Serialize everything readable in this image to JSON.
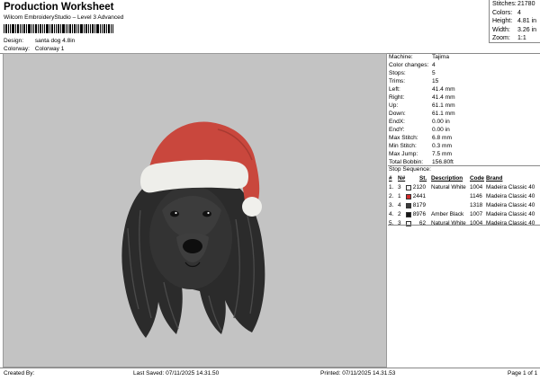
{
  "header": {
    "title": "Production Worksheet",
    "subtitle": "Wilcom EmbroideryStudio – Level 3 Advanced",
    "design_label": "Design:",
    "design_value": "santa dog 4.8in",
    "colorway_label": "Colorway:",
    "colorway_value": "Colorway 1"
  },
  "stats": [
    {
      "label": "Stitches:",
      "value": "21780"
    },
    {
      "label": "Colors:",
      "value": "4"
    },
    {
      "label": "Height:",
      "value": "4.81 in"
    },
    {
      "label": "Width:",
      "value": "3.26 in"
    },
    {
      "label": "Zoom:",
      "value": "1:1"
    }
  ],
  "info": [
    {
      "label": "Machine:",
      "value": "Tajima"
    },
    {
      "label": "Color changes:",
      "value": "4"
    },
    {
      "label": "Stops:",
      "value": "5"
    },
    {
      "label": "Trims:",
      "value": "15"
    },
    {
      "label": "Left:",
      "value": "41.4 mm"
    },
    {
      "label": "Right:",
      "value": "41.4 mm"
    },
    {
      "label": "Up:",
      "value": "61.1 mm"
    },
    {
      "label": "Down:",
      "value": "61.1 mm"
    },
    {
      "label": "EndX:",
      "value": "0.00 in"
    },
    {
      "label": "EndY:",
      "value": "0.00 in"
    },
    {
      "label": "Max Stitch:",
      "value": "6.8 mm"
    },
    {
      "label": "Min Stitch:",
      "value": "0.3 mm"
    },
    {
      "label": "Max Jump:",
      "value": "7.5 mm"
    },
    {
      "label": "Total Bobbin:",
      "value": "156.80ft"
    }
  ],
  "stop_sequence": {
    "title": "Stop Sequence:",
    "headers": {
      "num": "#",
      "n": "N#",
      "st": "St.",
      "desc": "Description",
      "code": "Code",
      "brand": "Brand"
    },
    "rows": [
      {
        "num": "1.",
        "n": "3",
        "color": "#f2f2f2",
        "st": "2120",
        "desc": "Natural White",
        "code": "1004",
        "brand": "Madeira Classic 40"
      },
      {
        "num": "2.",
        "n": "1",
        "color": "#d42a2a",
        "st": "2441",
        "desc": "",
        "code": "1146",
        "brand": "Madeira Classic 40"
      },
      {
        "num": "3.",
        "n": "4",
        "color": "#3a3a3a",
        "st": "8179",
        "desc": "",
        "code": "1318",
        "brand": "Madeira Classic 40"
      },
      {
        "num": "4.",
        "n": "2",
        "color": "#151515",
        "st": "8976",
        "desc": "Amber Black",
        "code": "1007",
        "brand": "Madeira Classic 40"
      },
      {
        "num": "5.",
        "n": "3",
        "color": "#f2f2f2",
        "st": "62",
        "desc": "Natural White",
        "code": "1004",
        "brand": "Madeira Classic 40"
      }
    ]
  },
  "footer": {
    "created_by": "Created By:",
    "last_saved": "Last Saved: 07/11/2025 14.31.50",
    "printed": "Printed: 07/11/2025 14.31.53",
    "page": "Page 1 of 1"
  }
}
